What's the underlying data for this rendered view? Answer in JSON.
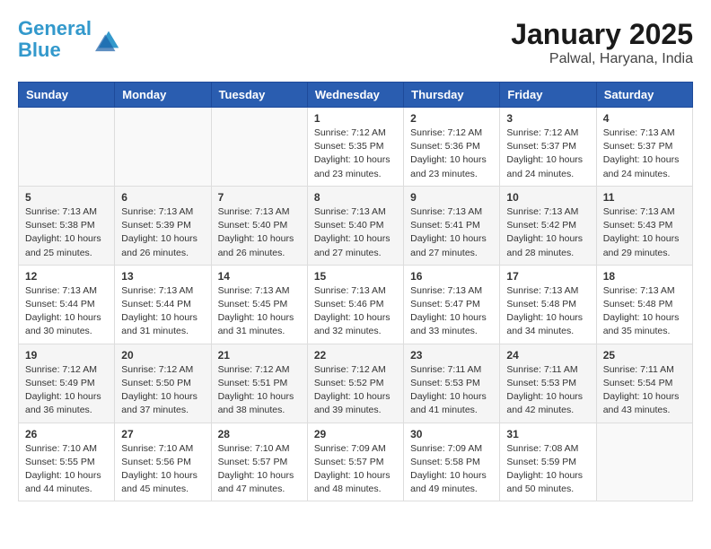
{
  "header": {
    "logo_line1": "General",
    "logo_line2": "Blue",
    "title": "January 2025",
    "subtitle": "Palwal, Haryana, India"
  },
  "weekdays": [
    "Sunday",
    "Monday",
    "Tuesday",
    "Wednesday",
    "Thursday",
    "Friday",
    "Saturday"
  ],
  "weeks": [
    [
      {
        "day": "",
        "info": ""
      },
      {
        "day": "",
        "info": ""
      },
      {
        "day": "",
        "info": ""
      },
      {
        "day": "1",
        "info": "Sunrise: 7:12 AM\nSunset: 5:35 PM\nDaylight: 10 hours\nand 23 minutes."
      },
      {
        "day": "2",
        "info": "Sunrise: 7:12 AM\nSunset: 5:36 PM\nDaylight: 10 hours\nand 23 minutes."
      },
      {
        "day": "3",
        "info": "Sunrise: 7:12 AM\nSunset: 5:37 PM\nDaylight: 10 hours\nand 24 minutes."
      },
      {
        "day": "4",
        "info": "Sunrise: 7:13 AM\nSunset: 5:37 PM\nDaylight: 10 hours\nand 24 minutes."
      }
    ],
    [
      {
        "day": "5",
        "info": "Sunrise: 7:13 AM\nSunset: 5:38 PM\nDaylight: 10 hours\nand 25 minutes."
      },
      {
        "day": "6",
        "info": "Sunrise: 7:13 AM\nSunset: 5:39 PM\nDaylight: 10 hours\nand 26 minutes."
      },
      {
        "day": "7",
        "info": "Sunrise: 7:13 AM\nSunset: 5:40 PM\nDaylight: 10 hours\nand 26 minutes."
      },
      {
        "day": "8",
        "info": "Sunrise: 7:13 AM\nSunset: 5:40 PM\nDaylight: 10 hours\nand 27 minutes."
      },
      {
        "day": "9",
        "info": "Sunrise: 7:13 AM\nSunset: 5:41 PM\nDaylight: 10 hours\nand 27 minutes."
      },
      {
        "day": "10",
        "info": "Sunrise: 7:13 AM\nSunset: 5:42 PM\nDaylight: 10 hours\nand 28 minutes."
      },
      {
        "day": "11",
        "info": "Sunrise: 7:13 AM\nSunset: 5:43 PM\nDaylight: 10 hours\nand 29 minutes."
      }
    ],
    [
      {
        "day": "12",
        "info": "Sunrise: 7:13 AM\nSunset: 5:44 PM\nDaylight: 10 hours\nand 30 minutes."
      },
      {
        "day": "13",
        "info": "Sunrise: 7:13 AM\nSunset: 5:44 PM\nDaylight: 10 hours\nand 31 minutes."
      },
      {
        "day": "14",
        "info": "Sunrise: 7:13 AM\nSunset: 5:45 PM\nDaylight: 10 hours\nand 31 minutes."
      },
      {
        "day": "15",
        "info": "Sunrise: 7:13 AM\nSunset: 5:46 PM\nDaylight: 10 hours\nand 32 minutes."
      },
      {
        "day": "16",
        "info": "Sunrise: 7:13 AM\nSunset: 5:47 PM\nDaylight: 10 hours\nand 33 minutes."
      },
      {
        "day": "17",
        "info": "Sunrise: 7:13 AM\nSunset: 5:48 PM\nDaylight: 10 hours\nand 34 minutes."
      },
      {
        "day": "18",
        "info": "Sunrise: 7:13 AM\nSunset: 5:48 PM\nDaylight: 10 hours\nand 35 minutes."
      }
    ],
    [
      {
        "day": "19",
        "info": "Sunrise: 7:12 AM\nSunset: 5:49 PM\nDaylight: 10 hours\nand 36 minutes."
      },
      {
        "day": "20",
        "info": "Sunrise: 7:12 AM\nSunset: 5:50 PM\nDaylight: 10 hours\nand 37 minutes."
      },
      {
        "day": "21",
        "info": "Sunrise: 7:12 AM\nSunset: 5:51 PM\nDaylight: 10 hours\nand 38 minutes."
      },
      {
        "day": "22",
        "info": "Sunrise: 7:12 AM\nSunset: 5:52 PM\nDaylight: 10 hours\nand 39 minutes."
      },
      {
        "day": "23",
        "info": "Sunrise: 7:11 AM\nSunset: 5:53 PM\nDaylight: 10 hours\nand 41 minutes."
      },
      {
        "day": "24",
        "info": "Sunrise: 7:11 AM\nSunset: 5:53 PM\nDaylight: 10 hours\nand 42 minutes."
      },
      {
        "day": "25",
        "info": "Sunrise: 7:11 AM\nSunset: 5:54 PM\nDaylight: 10 hours\nand 43 minutes."
      }
    ],
    [
      {
        "day": "26",
        "info": "Sunrise: 7:10 AM\nSunset: 5:55 PM\nDaylight: 10 hours\nand 44 minutes."
      },
      {
        "day": "27",
        "info": "Sunrise: 7:10 AM\nSunset: 5:56 PM\nDaylight: 10 hours\nand 45 minutes."
      },
      {
        "day": "28",
        "info": "Sunrise: 7:10 AM\nSunset: 5:57 PM\nDaylight: 10 hours\nand 47 minutes."
      },
      {
        "day": "29",
        "info": "Sunrise: 7:09 AM\nSunset: 5:57 PM\nDaylight: 10 hours\nand 48 minutes."
      },
      {
        "day": "30",
        "info": "Sunrise: 7:09 AM\nSunset: 5:58 PM\nDaylight: 10 hours\nand 49 minutes."
      },
      {
        "day": "31",
        "info": "Sunrise: 7:08 AM\nSunset: 5:59 PM\nDaylight: 10 hours\nand 50 minutes."
      },
      {
        "day": "",
        "info": ""
      }
    ]
  ]
}
